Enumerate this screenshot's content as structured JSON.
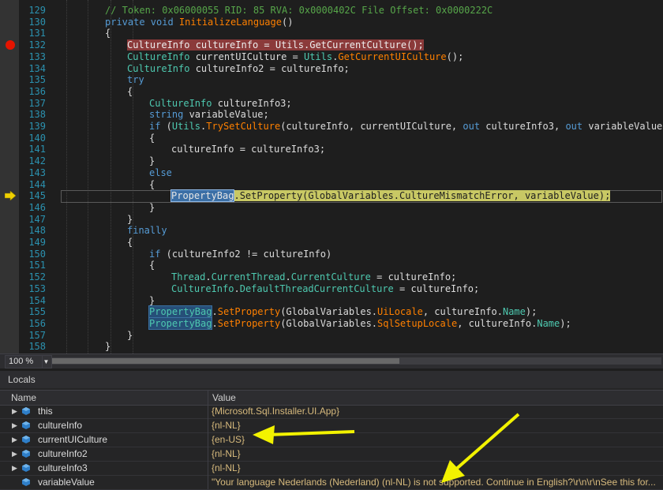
{
  "editor": {
    "lines": [
      {
        "num": "129",
        "indent": 0,
        "tokens": [
          {
            "t": "// Token: 0x06000055 RID: 85 RVA: 0x0000402C File Offset: 0x0000222C",
            "c": "comment"
          }
        ]
      },
      {
        "num": "130",
        "indent": 0,
        "tokens": [
          {
            "t": "private ",
            "c": "keyword"
          },
          {
            "t": "void ",
            "c": "keyword"
          },
          {
            "t": "InitializeLanguage",
            "c": "method"
          },
          {
            "t": "()",
            "c": "plain"
          }
        ]
      },
      {
        "num": "131",
        "indent": 0,
        "tokens": [
          {
            "t": "{",
            "c": "plain"
          }
        ]
      },
      {
        "num": "132",
        "indent": 1,
        "marker": "breakpoint",
        "highlight": "break",
        "tokens": [
          {
            "t": "CultureInfo",
            "c": "type"
          },
          {
            "t": " cultureInfo = ",
            "c": "plain"
          },
          {
            "t": "Utils",
            "c": "type"
          },
          {
            "t": ".",
            "c": "plain"
          },
          {
            "t": "GetCurrentCulture",
            "c": "method"
          },
          {
            "t": "();",
            "c": "plain"
          }
        ]
      },
      {
        "num": "133",
        "indent": 1,
        "tokens": [
          {
            "t": "CultureInfo",
            "c": "type"
          },
          {
            "t": " currentUICulture = ",
            "c": "plain"
          },
          {
            "t": "Utils",
            "c": "type"
          },
          {
            "t": ".",
            "c": "plain"
          },
          {
            "t": "GetCurrentUICulture",
            "c": "method"
          },
          {
            "t": "();",
            "c": "plain"
          }
        ]
      },
      {
        "num": "134",
        "indent": 1,
        "tokens": [
          {
            "t": "CultureInfo",
            "c": "type"
          },
          {
            "t": " cultureInfo2 = cultureInfo;",
            "c": "plain"
          }
        ]
      },
      {
        "num": "135",
        "indent": 1,
        "tokens": [
          {
            "t": "try",
            "c": "keyword"
          }
        ]
      },
      {
        "num": "136",
        "indent": 1,
        "tokens": [
          {
            "t": "{",
            "c": "plain"
          }
        ]
      },
      {
        "num": "137",
        "indent": 2,
        "tokens": [
          {
            "t": "CultureInfo",
            "c": "type"
          },
          {
            "t": " cultureInfo3;",
            "c": "plain"
          }
        ]
      },
      {
        "num": "138",
        "indent": 2,
        "tokens": [
          {
            "t": "string",
            "c": "keyword"
          },
          {
            "t": " variableValue;",
            "c": "plain"
          }
        ]
      },
      {
        "num": "139",
        "indent": 2,
        "tokens": [
          {
            "t": "if",
            "c": "keyword"
          },
          {
            "t": " (",
            "c": "plain"
          },
          {
            "t": "Utils",
            "c": "type"
          },
          {
            "t": ".",
            "c": "plain"
          },
          {
            "t": "TrySetCulture",
            "c": "method"
          },
          {
            "t": "(cultureInfo, currentUICulture, ",
            "c": "plain"
          },
          {
            "t": "out",
            "c": "keyword"
          },
          {
            "t": " cultureInfo3, ",
            "c": "plain"
          },
          {
            "t": "out",
            "c": "keyword"
          },
          {
            "t": " variableValue))",
            "c": "plain"
          }
        ]
      },
      {
        "num": "140",
        "indent": 2,
        "tokens": [
          {
            "t": "{",
            "c": "plain"
          }
        ]
      },
      {
        "num": "141",
        "indent": 3,
        "tokens": [
          {
            "t": "cultureInfo = cultureInfo3;",
            "c": "plain"
          }
        ]
      },
      {
        "num": "142",
        "indent": 2,
        "tokens": [
          {
            "t": "}",
            "c": "plain"
          }
        ]
      },
      {
        "num": "143",
        "indent": 2,
        "tokens": [
          {
            "t": "else",
            "c": "keyword"
          }
        ]
      },
      {
        "num": "144",
        "indent": 2,
        "tokens": [
          {
            "t": "{",
            "c": "plain"
          }
        ]
      },
      {
        "num": "145",
        "indent": 3,
        "marker": "current",
        "highlight": "current",
        "tokens": [
          {
            "t": "PropertyBag",
            "c": "type",
            "sel": true
          },
          {
            "t": ".SetProperty(GlobalVariables.CultureMismatchError, variableValue);",
            "c": "plain"
          }
        ]
      },
      {
        "num": "146",
        "indent": 2,
        "tokens": [
          {
            "t": "}",
            "c": "plain"
          }
        ]
      },
      {
        "num": "147",
        "indent": 1,
        "tokens": [
          {
            "t": "}",
            "c": "plain"
          }
        ]
      },
      {
        "num": "148",
        "indent": 1,
        "tokens": [
          {
            "t": "finally",
            "c": "keyword"
          }
        ]
      },
      {
        "num": "149",
        "indent": 1,
        "tokens": [
          {
            "t": "{",
            "c": "plain"
          }
        ]
      },
      {
        "num": "150",
        "indent": 2,
        "tokens": [
          {
            "t": "if",
            "c": "keyword"
          },
          {
            "t": " (cultureInfo2 != cultureInfo)",
            "c": "plain"
          }
        ]
      },
      {
        "num": "151",
        "indent": 2,
        "tokens": [
          {
            "t": "{",
            "c": "plain"
          }
        ]
      },
      {
        "num": "152",
        "indent": 3,
        "tokens": [
          {
            "t": "Thread",
            "c": "type"
          },
          {
            "t": ".",
            "c": "plain"
          },
          {
            "t": "CurrentThread",
            "c": "prop"
          },
          {
            "t": ".",
            "c": "plain"
          },
          {
            "t": "CurrentCulture",
            "c": "prop"
          },
          {
            "t": " = cultureInfo;",
            "c": "plain"
          }
        ]
      },
      {
        "num": "153",
        "indent": 3,
        "tokens": [
          {
            "t": "CultureInfo",
            "c": "type"
          },
          {
            "t": ".",
            "c": "plain"
          },
          {
            "t": "DefaultThreadCurrentCulture",
            "c": "prop"
          },
          {
            "t": " = cultureInfo;",
            "c": "plain"
          }
        ]
      },
      {
        "num": "154",
        "indent": 2,
        "tokens": [
          {
            "t": "}",
            "c": "plain"
          }
        ]
      },
      {
        "num": "155",
        "indent": 2,
        "tokens": [
          {
            "t": "PropertyBag",
            "c": "type",
            "sel": true
          },
          {
            "t": ".",
            "c": "plain"
          },
          {
            "t": "SetProperty",
            "c": "method"
          },
          {
            "t": "(GlobalVariables.",
            "c": "plain"
          },
          {
            "t": "UiLocale",
            "c": "method"
          },
          {
            "t": ", cultureInfo.",
            "c": "plain"
          },
          {
            "t": "Name",
            "c": "prop"
          },
          {
            "t": ");",
            "c": "plain"
          }
        ]
      },
      {
        "num": "156",
        "indent": 2,
        "tokens": [
          {
            "t": "PropertyBag",
            "c": "type",
            "sel": true
          },
          {
            "t": ".",
            "c": "plain"
          },
          {
            "t": "SetProperty",
            "c": "method"
          },
          {
            "t": "(GlobalVariables.",
            "c": "plain"
          },
          {
            "t": "SqlSetupLocale",
            "c": "method"
          },
          {
            "t": ", cultureInfo.",
            "c": "plain"
          },
          {
            "t": "Name",
            "c": "prop"
          },
          {
            "t": ");",
            "c": "plain"
          }
        ]
      },
      {
        "num": "157",
        "indent": 1,
        "tokens": [
          {
            "t": "}",
            "c": "plain"
          }
        ]
      },
      {
        "num": "158",
        "indent": 0,
        "tokens": [
          {
            "t": "}",
            "c": "plain"
          }
        ]
      }
    ]
  },
  "statusbar": {
    "zoom": "100 %"
  },
  "locals": {
    "title": "Locals",
    "columns": {
      "name": "Name",
      "value": "Value"
    },
    "rows": [
      {
        "name": "this",
        "value": "{Microsoft.Sql.Installer.UI.App}",
        "kind": "this",
        "expandable": true
      },
      {
        "name": "cultureInfo",
        "value": "{nl-NL}",
        "kind": "blue",
        "expandable": true
      },
      {
        "name": "currentUICulture",
        "value": "{en-US}",
        "kind": "blue",
        "expandable": true
      },
      {
        "name": "cultureInfo2",
        "value": "{nl-NL}",
        "kind": "blue",
        "expandable": true
      },
      {
        "name": "cultureInfo3",
        "value": "{nl-NL}",
        "kind": "blue",
        "expandable": true
      },
      {
        "name": "variableValue",
        "value": "\"Your language Nederlands (Nederland) (nl-NL) is not supported. Continue in English?\\r\\n\\r\\nSee this for...",
        "kind": "str",
        "expandable": false
      }
    ]
  },
  "colors": {
    "annotation_arrow": "#f2f200",
    "breakpoint": "#e51400",
    "current_line": "#c8c864"
  }
}
